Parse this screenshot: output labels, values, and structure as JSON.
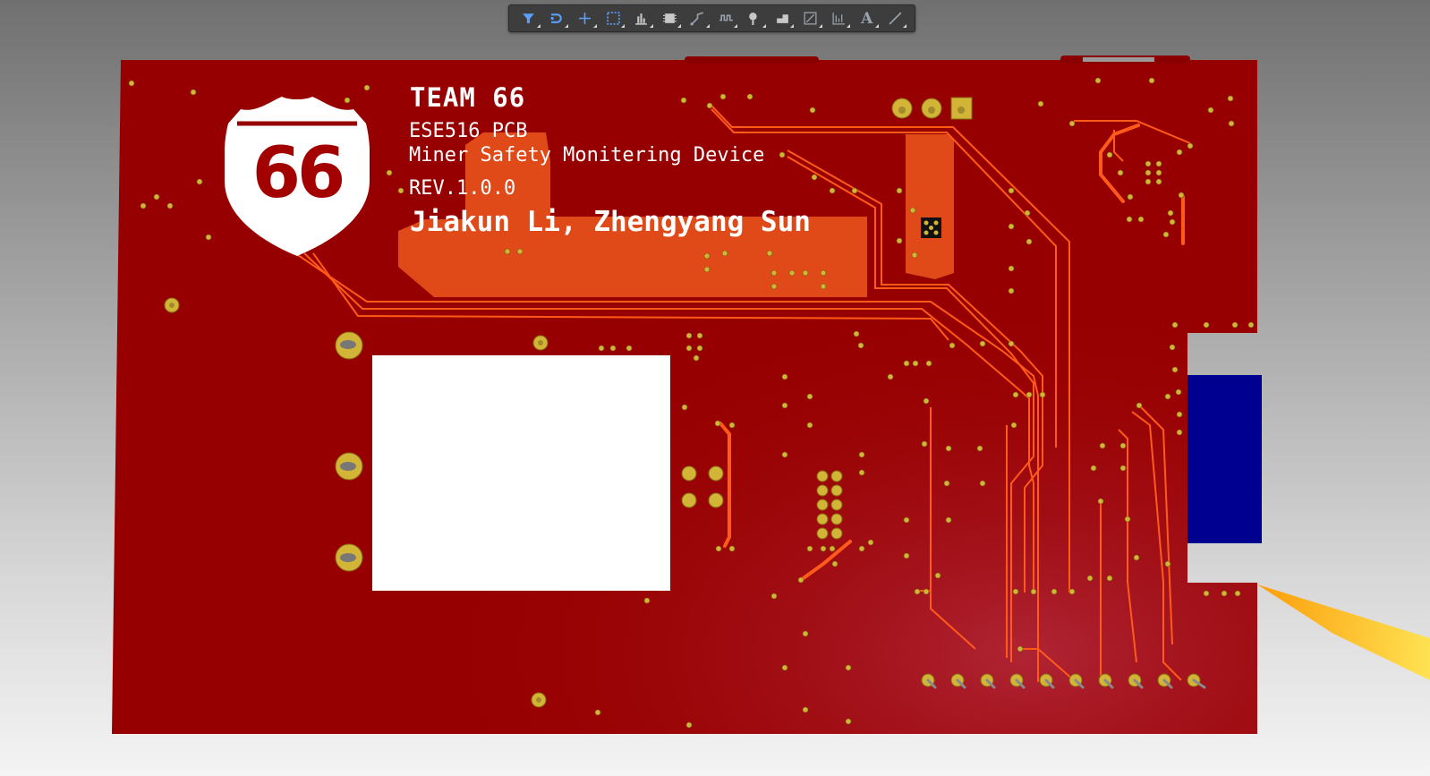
{
  "toolbar": {
    "tools": [
      {
        "name": "filter-icon"
      },
      {
        "name": "interactive-routing-icon"
      },
      {
        "name": "place-cross-icon"
      },
      {
        "name": "select-rectangle-icon"
      },
      {
        "name": "align-icon"
      },
      {
        "name": "component-icon"
      },
      {
        "name": "route-icon"
      },
      {
        "name": "tune-length-icon"
      },
      {
        "name": "via-icon"
      },
      {
        "name": "polygon-pour-icon"
      },
      {
        "name": "dimension-icon"
      },
      {
        "name": "graphic-icon"
      },
      {
        "name": "text-icon",
        "glyph": "A"
      },
      {
        "name": "line-icon"
      }
    ]
  },
  "board": {
    "logo_text": "66",
    "silkscreen": {
      "team": "TEAM 66",
      "course": "ESE516 PCB",
      "project": "Miner Safety Monitering Device",
      "revision": "REV.1.0.0",
      "authors": "Jiakun Li, Zhengyang Sun"
    },
    "colors": {
      "board": "#970000",
      "copper": "#e04a18",
      "trace": "#ff5a1a",
      "pad": "#d2b437",
      "silkscreen": "#ffffff",
      "connector": "#000090"
    }
  }
}
